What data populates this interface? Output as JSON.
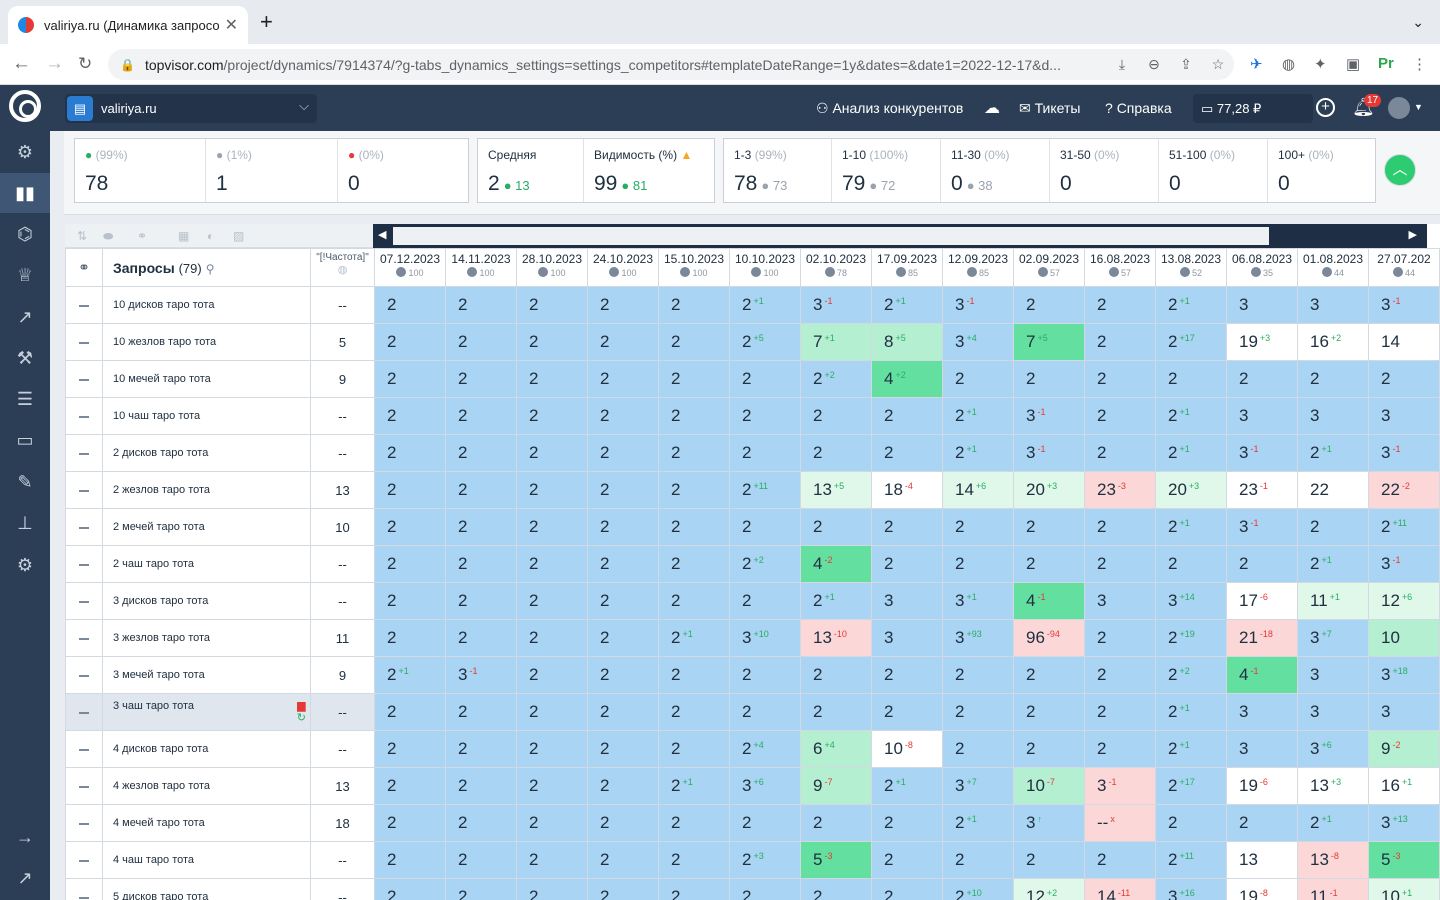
{
  "browser": {
    "tab_title": "valiriya.ru (Динамика запросо",
    "url_host": "topvisor.com",
    "url_path": "/project/dynamics/7914374/?g-tabs_dynamics_settings=settings_competitors#templateDateRange=1y&dates=&date1=2022-12-17&d..."
  },
  "header": {
    "project": "valiriya.ru",
    "competitors": "Анализ конкурентов",
    "tickets": "Тикеты",
    "help": "Справка",
    "balance": "77,28 ₽",
    "notifications": "17"
  },
  "summary": {
    "up": {
      "pct": "(99%)",
      "value": "78"
    },
    "same": {
      "pct": "(1%)",
      "value": "1"
    },
    "down": {
      "pct": "(0%)",
      "value": "0"
    },
    "avg": {
      "label": "Средняя",
      "value": "2",
      "change": "13"
    },
    "visibility": {
      "label": "Видимость (%)",
      "value": "99",
      "change": "81"
    },
    "ranges": [
      {
        "label": "1-3",
        "pct": "(99%)",
        "value": "78",
        "prev": "73"
      },
      {
        "label": "1-10",
        "pct": "(100%)",
        "value": "79",
        "prev": "72"
      },
      {
        "label": "11-30",
        "pct": "(0%)",
        "value": "0",
        "prev": "38"
      },
      {
        "label": "31-50",
        "pct": "(0%)",
        "value": "0",
        "prev": ""
      },
      {
        "label": "51-100",
        "pct": "(0%)",
        "value": "0",
        "prev": ""
      },
      {
        "label": "100+",
        "pct": "(0%)",
        "value": "0",
        "prev": ""
      }
    ]
  },
  "table": {
    "queries_label": "Запросы",
    "queries_count": "(79)",
    "freq_label": "\"[!Частота]\"",
    "dates": [
      {
        "d": "07.12.2023",
        "v": "100"
      },
      {
        "d": "14.11.2023",
        "v": "100"
      },
      {
        "d": "28.10.2023",
        "v": "100"
      },
      {
        "d": "24.10.2023",
        "v": "100"
      },
      {
        "d": "15.10.2023",
        "v": "100"
      },
      {
        "d": "10.10.2023",
        "v": "100"
      },
      {
        "d": "02.10.2023",
        "v": "78"
      },
      {
        "d": "17.09.2023",
        "v": "85"
      },
      {
        "d": "12.09.2023",
        "v": "85"
      },
      {
        "d": "02.09.2023",
        "v": "57"
      },
      {
        "d": "16.08.2023",
        "v": "57"
      },
      {
        "d": "13.08.2023",
        "v": "52"
      },
      {
        "d": "06.08.2023",
        "v": "35"
      },
      {
        "d": "01.08.2023",
        "v": "44"
      },
      {
        "d": "27.07.202",
        "v": "44"
      }
    ],
    "rows": [
      {
        "q": "10 дисков таро тота",
        "f": "--",
        "c": [
          [
            "2"
          ],
          [
            "2"
          ],
          [
            "2"
          ],
          [
            "2"
          ],
          [
            "2"
          ],
          [
            "2",
            "+1"
          ],
          [
            "3",
            "-1"
          ],
          [
            "2",
            "+1"
          ],
          [
            "3",
            "-1"
          ],
          [
            "2"
          ],
          [
            "2"
          ],
          [
            "2",
            "+1"
          ],
          [
            "3"
          ],
          [
            "3"
          ],
          [
            "3",
            "-1"
          ]
        ]
      },
      {
        "q": "10 жезлов таро тота",
        "f": "5",
        "c": [
          [
            "2"
          ],
          [
            "2"
          ],
          [
            "2"
          ],
          [
            "2"
          ],
          [
            "2"
          ],
          [
            "2",
            "+5"
          ],
          [
            "7",
            "+1",
            "g"
          ],
          [
            "8",
            "+5",
            "g"
          ],
          [
            "3",
            "+4"
          ],
          [
            "7",
            "+5",
            "G"
          ],
          [
            "2"
          ],
          [
            "2",
            "+17"
          ],
          [
            "19",
            "+3",
            "w"
          ],
          [
            "16",
            "+2",
            "w"
          ],
          [
            "14",
            "",
            "w"
          ]
        ]
      },
      {
        "q": "10 мечей таро тота",
        "f": "9",
        "c": [
          [
            "2"
          ],
          [
            "2"
          ],
          [
            "2"
          ],
          [
            "2"
          ],
          [
            "2"
          ],
          [
            "2"
          ],
          [
            "2",
            "+2"
          ],
          [
            "4",
            "+2",
            "G"
          ],
          [
            "2"
          ],
          [
            "2"
          ],
          [
            "2"
          ],
          [
            "2"
          ],
          [
            "2"
          ],
          [
            "2"
          ],
          [
            "2"
          ]
        ]
      },
      {
        "q": "10 чаш таро тота",
        "f": "--",
        "c": [
          [
            "2"
          ],
          [
            "2"
          ],
          [
            "2"
          ],
          [
            "2"
          ],
          [
            "2"
          ],
          [
            "2"
          ],
          [
            "2"
          ],
          [
            "2"
          ],
          [
            "2",
            "+1"
          ],
          [
            "3",
            "-1"
          ],
          [
            "2"
          ],
          [
            "2",
            "+1"
          ],
          [
            "3"
          ],
          [
            "3"
          ],
          [
            "3"
          ]
        ]
      },
      {
        "q": "2 дисков таро тота",
        "f": "--",
        "c": [
          [
            "2"
          ],
          [
            "2"
          ],
          [
            "2"
          ],
          [
            "2"
          ],
          [
            "2"
          ],
          [
            "2"
          ],
          [
            "2"
          ],
          [
            "2"
          ],
          [
            "2",
            "+1"
          ],
          [
            "3",
            "-1"
          ],
          [
            "2"
          ],
          [
            "2",
            "+1"
          ],
          [
            "3",
            "-1"
          ],
          [
            "2",
            "+1"
          ],
          [
            "3",
            "-1"
          ]
        ]
      },
      {
        "q": "2 жезлов таро тота",
        "f": "13",
        "c": [
          [
            "2"
          ],
          [
            "2"
          ],
          [
            "2"
          ],
          [
            "2"
          ],
          [
            "2"
          ],
          [
            "2",
            "+11"
          ],
          [
            "13",
            "+5",
            "l"
          ],
          [
            "18",
            "-4",
            "w"
          ],
          [
            "14",
            "+6",
            "l"
          ],
          [
            "20",
            "+3",
            "l"
          ],
          [
            "23",
            "-3",
            "r"
          ],
          [
            "20",
            "+3",
            "l"
          ],
          [
            "23",
            "-1",
            "w"
          ],
          [
            "22",
            "",
            "w"
          ],
          [
            "22",
            "-2",
            "r"
          ]
        ]
      },
      {
        "q": "2 мечей таро тота",
        "f": "10",
        "c": [
          [
            "2"
          ],
          [
            "2"
          ],
          [
            "2"
          ],
          [
            "2"
          ],
          [
            "2"
          ],
          [
            "2"
          ],
          [
            "2"
          ],
          [
            "2"
          ],
          [
            "2"
          ],
          [
            "2"
          ],
          [
            "2"
          ],
          [
            "2",
            "+1"
          ],
          [
            "3",
            "-1"
          ],
          [
            "2"
          ],
          [
            "2",
            "+11"
          ]
        ]
      },
      {
        "q": "2 чаш таро тота",
        "f": "--",
        "c": [
          [
            "2"
          ],
          [
            "2"
          ],
          [
            "2"
          ],
          [
            "2"
          ],
          [
            "2"
          ],
          [
            "2",
            "+2"
          ],
          [
            "4",
            "-2",
            "G"
          ],
          [
            "2"
          ],
          [
            "2"
          ],
          [
            "2"
          ],
          [
            "2"
          ],
          [
            "2"
          ],
          [
            "2"
          ],
          [
            "2",
            "+1"
          ],
          [
            "3",
            "-1"
          ]
        ]
      },
      {
        "q": "3 дисков таро тота",
        "f": "--",
        "c": [
          [
            "2"
          ],
          [
            "2"
          ],
          [
            "2"
          ],
          [
            "2"
          ],
          [
            "2"
          ],
          [
            "2"
          ],
          [
            "2",
            "+1"
          ],
          [
            "3"
          ],
          [
            "3",
            "+1"
          ],
          [
            "4",
            "-1",
            "G"
          ],
          [
            "3"
          ],
          [
            "3",
            "+14"
          ],
          [
            "17",
            "-6",
            "w"
          ],
          [
            "11",
            "+1",
            "l"
          ],
          [
            "12",
            "+6",
            "l"
          ]
        ]
      },
      {
        "q": "3 жезлов таро тота",
        "f": "11",
        "c": [
          [
            "2"
          ],
          [
            "2"
          ],
          [
            "2"
          ],
          [
            "2"
          ],
          [
            "2",
            "+1"
          ],
          [
            "3",
            "+10"
          ],
          [
            "13",
            "-10",
            "r"
          ],
          [
            "3"
          ],
          [
            "3",
            "+93"
          ],
          [
            "96",
            "-94",
            "r"
          ],
          [
            "2"
          ],
          [
            "2",
            "+19"
          ],
          [
            "21",
            "-18",
            "r"
          ],
          [
            "3",
            "+7"
          ],
          [
            "10",
            "",
            "g"
          ]
        ]
      },
      {
        "q": "3 мечей таро тота",
        "f": "9",
        "c": [
          [
            "2",
            "+1"
          ],
          [
            "3",
            "-1"
          ],
          [
            "2"
          ],
          [
            "2"
          ],
          [
            "2"
          ],
          [
            "2"
          ],
          [
            "2"
          ],
          [
            "2"
          ],
          [
            "2"
          ],
          [
            "2"
          ],
          [
            "2"
          ],
          [
            "2",
            "+2"
          ],
          [
            "4",
            "-1",
            "G"
          ],
          [
            "3"
          ],
          [
            "3",
            "+18"
          ]
        ]
      },
      {
        "q": "3 чаш таро тота",
        "f": "--",
        "sel": true,
        "c": [
          [
            "2"
          ],
          [
            "2"
          ],
          [
            "2"
          ],
          [
            "2"
          ],
          [
            "2"
          ],
          [
            "2"
          ],
          [
            "2"
          ],
          [
            "2"
          ],
          [
            "2"
          ],
          [
            "2"
          ],
          [
            "2"
          ],
          [
            "2",
            "+1"
          ],
          [
            "3"
          ],
          [
            "3"
          ],
          [
            "3"
          ]
        ]
      },
      {
        "q": "4 дисков таро тота",
        "f": "--",
        "c": [
          [
            "2"
          ],
          [
            "2"
          ],
          [
            "2"
          ],
          [
            "2"
          ],
          [
            "2"
          ],
          [
            "2",
            "+4"
          ],
          [
            "6",
            "+4",
            "g"
          ],
          [
            "10",
            "-8",
            "w"
          ],
          [
            "2"
          ],
          [
            "2"
          ],
          [
            "2"
          ],
          [
            "2",
            "+1"
          ],
          [
            "3"
          ],
          [
            "3",
            "+6"
          ],
          [
            "9",
            "-2",
            "g"
          ]
        ]
      },
      {
        "q": "4 жезлов таро тота",
        "f": "13",
        "c": [
          [
            "2"
          ],
          [
            "2"
          ],
          [
            "2"
          ],
          [
            "2"
          ],
          [
            "2",
            "+1"
          ],
          [
            "3",
            "+6"
          ],
          [
            "9",
            "-7",
            "g"
          ],
          [
            "2",
            "+1"
          ],
          [
            "3",
            "+7"
          ],
          [
            "10",
            "-7",
            "g"
          ],
          [
            "3",
            "-1",
            "r"
          ],
          [
            "2",
            "+17"
          ],
          [
            "19",
            "-6",
            "w"
          ],
          [
            "13",
            "+3",
            "w"
          ],
          [
            "16",
            "+1",
            "w"
          ]
        ]
      },
      {
        "q": "4 мечей таро тота",
        "f": "18",
        "c": [
          [
            "2"
          ],
          [
            "2"
          ],
          [
            "2"
          ],
          [
            "2"
          ],
          [
            "2"
          ],
          [
            "2"
          ],
          [
            "2"
          ],
          [
            "2"
          ],
          [
            "2",
            "+1"
          ],
          [
            "3",
            "↑"
          ],
          [
            "--",
            "x",
            "r"
          ],
          [
            "2"
          ],
          [
            "2"
          ],
          [
            "2",
            "+1"
          ],
          [
            "3",
            "+13"
          ]
        ]
      },
      {
        "q": "4 чаш таро тота",
        "f": "--",
        "c": [
          [
            "2"
          ],
          [
            "2"
          ],
          [
            "2"
          ],
          [
            "2"
          ],
          [
            "2"
          ],
          [
            "2",
            "+3"
          ],
          [
            "5",
            "-3",
            "G"
          ],
          [
            "2"
          ],
          [
            "2"
          ],
          [
            "2"
          ],
          [
            "2"
          ],
          [
            "2",
            "+11"
          ],
          [
            "13",
            "",
            "w"
          ],
          [
            "13",
            "-8",
            "r"
          ],
          [
            "5",
            "-3",
            "G"
          ]
        ]
      },
      {
        "q": "5 дисков таро тота",
        "f": "--",
        "c": [
          [
            "2"
          ],
          [
            "2"
          ],
          [
            "2"
          ],
          [
            "2"
          ],
          [
            "2"
          ],
          [
            "2"
          ],
          [
            "2"
          ],
          [
            "2"
          ],
          [
            "2",
            "+10"
          ],
          [
            "12",
            "+2",
            "l"
          ],
          [
            "14",
            "-11",
            "r"
          ],
          [
            "3",
            "+16"
          ],
          [
            "19",
            "-8",
            "w"
          ],
          [
            "11",
            "-1",
            "r"
          ],
          [
            "10",
            "+1",
            "l"
          ]
        ]
      }
    ]
  }
}
